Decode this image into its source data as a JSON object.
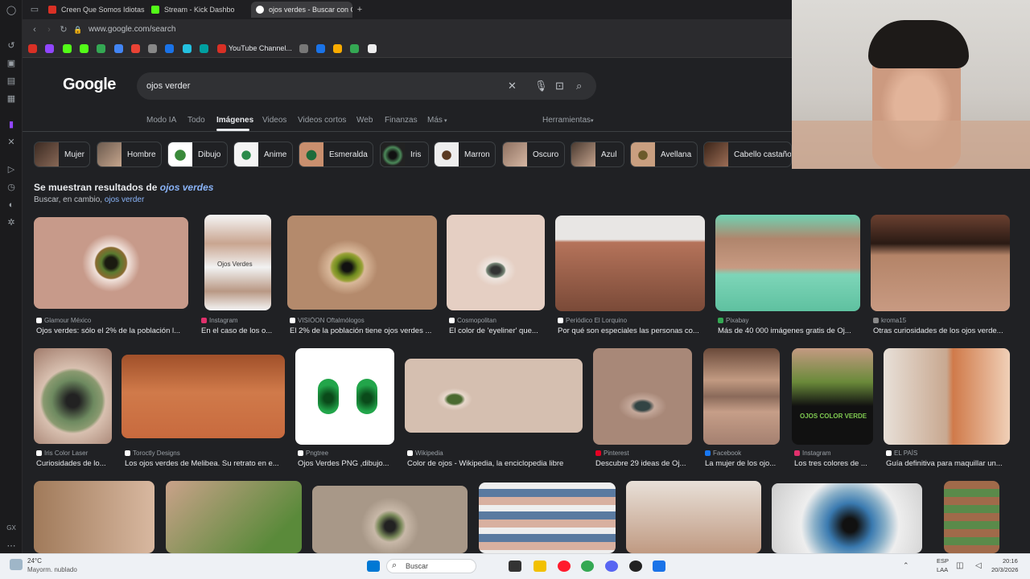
{
  "tabs": [
    {
      "label": "Creen Que Somos Idiotas",
      "color": "#d93025"
    },
    {
      "label": "Stream - Kick Dashbo",
      "color": "#53fc18"
    },
    {
      "label": "ojos verdes - Buscar con G",
      "color": "#4285f4"
    }
  ],
  "address": {
    "url": "www.google.com/search"
  },
  "bookmarks": {
    "youtube_label": "YouTube Channel..."
  },
  "google": {
    "logo": "Google",
    "query": "ojos verder",
    "filters": [
      "Modo IA",
      "Todo",
      "Imágenes",
      "Videos",
      "Videos cortos",
      "Web",
      "Finanzas",
      "Más"
    ],
    "tools_label": "Herramientas"
  },
  "chips": [
    "Mujer",
    "Hombre",
    "Dibujo",
    "Anime",
    "Esmeralda",
    "Iris",
    "Marron",
    "Oscuro",
    "Azul",
    "Avellana",
    "Cabello castaño"
  ],
  "correction": {
    "showing_prefix": "Se muestran resultados de",
    "showing_link": "ojos verdes",
    "instead_prefix": "Buscar, en cambio,",
    "instead_link": "ojos verder"
  },
  "results_row1": [
    {
      "source": "Glamour México",
      "title": "Ojos verdes: sólo el 2% de la población l..."
    },
    {
      "source": "Instagram",
      "title": "En el caso de los o..."
    },
    {
      "source": "VISIÓON Oftalmólogos",
      "title": "El 2% de la población tiene ojos verdes ..."
    },
    {
      "source": "Cosmopolitan",
      "title": "El color de 'eyeliner' que..."
    },
    {
      "source": "Periódico El Lorquino",
      "title": "Por qué son especiales las personas co..."
    },
    {
      "source": "Pixabay",
      "title": "Más de 40 000 imágenes gratis de Oj..."
    },
    {
      "source": "kroma15",
      "title": "Otras curiosidades de los ojos verde..."
    }
  ],
  "results_row2": [
    {
      "source": "Iris Color Laser",
      "title": "Curiosidades de lo..."
    },
    {
      "source": "Toroctly Designs",
      "title": "Los ojos verdes de Melibea. Su retrato en e..."
    },
    {
      "source": "Pngtree",
      "title": "Ojos Verdes PNG ,dibujo..."
    },
    {
      "source": "Wikipedia",
      "title": "Color de ojos - Wikipedia, la enciclopedia libre"
    },
    {
      "source": "Pinterest",
      "title": "Descubre 29 ideas de Oj..."
    },
    {
      "source": "Facebook",
      "title": "La mujer de los ojo..."
    },
    {
      "source": "Instagram",
      "title": "Los tres colores de ..."
    },
    {
      "source": "EL PAÍS",
      "title": "Guía definitiva para maquillar un..."
    }
  ],
  "image_texts": {
    "thumb2": "Ojos Verdes",
    "poster": "OJOS COLOR VERDE"
  },
  "taskbar": {
    "weather_temp": "24°C",
    "weather_desc": "Mayorm. nublado",
    "search_label": "Buscar",
    "lang": "ESP",
    "lang2": "LAA",
    "time": "20:16",
    "date": "20/3/2026"
  }
}
